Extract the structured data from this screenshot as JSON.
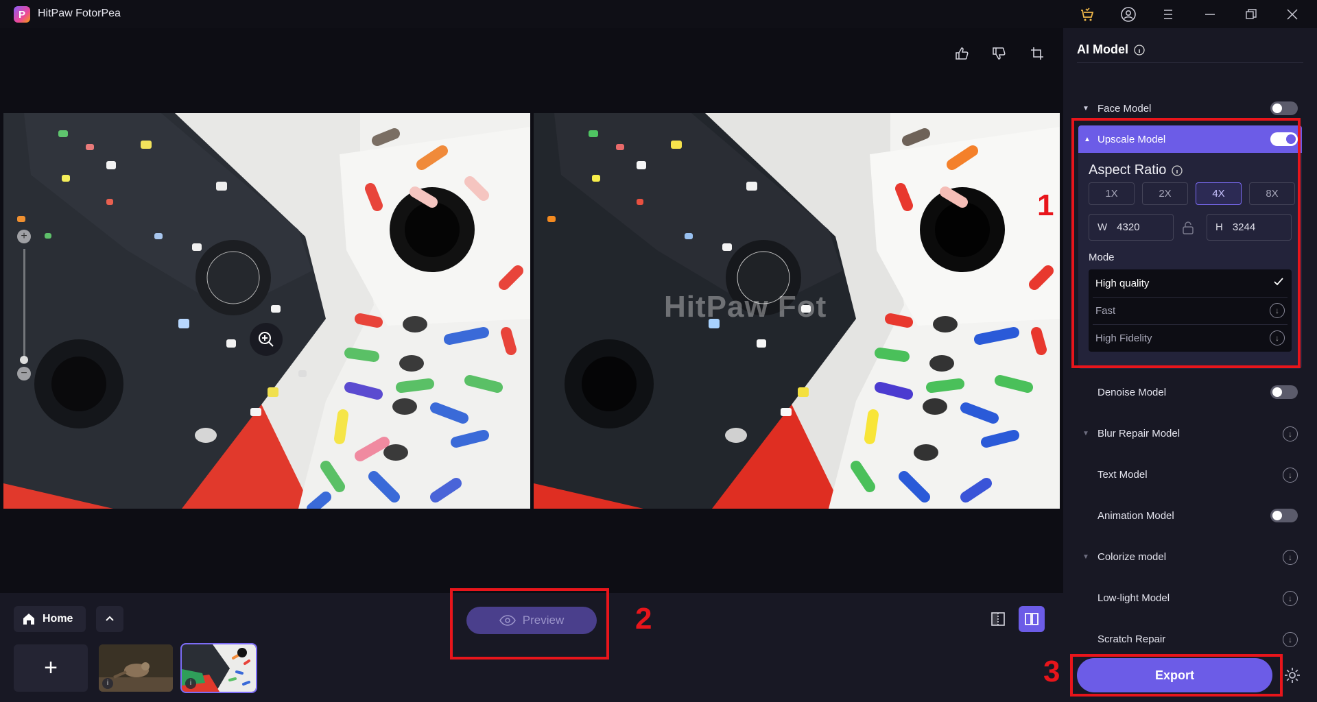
{
  "app": {
    "title": "HitPaw FotorPea",
    "logo_letter": "P"
  },
  "titlebar": {
    "icons": [
      "cart-icon",
      "account-icon",
      "menu-icon",
      "minimize-icon",
      "restore-icon",
      "close-icon"
    ]
  },
  "canvas": {
    "toolbar": [
      "thumbs-up-icon",
      "thumbs-down-icon",
      "crop-icon"
    ],
    "watermark": "HitPaw Fot",
    "zoom": {
      "plus": "+",
      "minus": "−",
      "level": 0.1
    }
  },
  "bottom": {
    "home_label": "Home",
    "add_label": "+",
    "preview_label": "Preview",
    "thumbnails": [
      {
        "name": "bird photo",
        "active": false
      },
      {
        "name": "watch bands photo",
        "active": true
      }
    ],
    "view_modes": [
      {
        "icon": "split-view-icon",
        "active": false
      },
      {
        "icon": "side-by-side-icon",
        "active": true
      }
    ]
  },
  "panel": {
    "title": "AI Model",
    "models": [
      {
        "key": "face",
        "name": "Face Model",
        "control": "toggle",
        "on": false,
        "expandable": true
      },
      {
        "key": "upscale",
        "name": "Upscale Model",
        "control": "toggle",
        "on": true,
        "expandable": true,
        "expanded": true
      },
      {
        "key": "denoise",
        "name": "Denoise Model",
        "control": "toggle",
        "on": false,
        "expandable": false
      },
      {
        "key": "blur",
        "name": "Blur Repair Model",
        "control": "download",
        "expandable": true
      },
      {
        "key": "text",
        "name": "Text Model",
        "control": "download",
        "expandable": false
      },
      {
        "key": "animation",
        "name": "Animation Model",
        "control": "toggle",
        "on": false,
        "expandable": false
      },
      {
        "key": "colorize",
        "name": "Colorize model",
        "control": "download",
        "expandable": true
      },
      {
        "key": "lowlight",
        "name": "Low-light Model",
        "control": "download",
        "expandable": false
      },
      {
        "key": "scratch",
        "name": "Scratch Repair",
        "control": "download",
        "expandable": false
      }
    ],
    "upscale": {
      "aspect_ratio_label": "Aspect Ratio",
      "ratios": [
        "1X",
        "2X",
        "4X",
        "8X"
      ],
      "selected_ratio": "4X",
      "width_label": "W",
      "width": "4320",
      "height_label": "H",
      "height": "3244",
      "mode_label": "Mode",
      "modes": [
        {
          "name": "High quality",
          "state": "selected"
        },
        {
          "name": "Fast",
          "state": "download"
        },
        {
          "name": "High Fidelity",
          "state": "download"
        }
      ]
    },
    "export_label": "Export"
  },
  "annotations": [
    "1",
    "2",
    "3"
  ],
  "colors": {
    "accent": "#6c5ce7",
    "annotation_red": "#e8151b",
    "panel_bg": "#181824",
    "canvas_bg": "#0d0d14"
  }
}
